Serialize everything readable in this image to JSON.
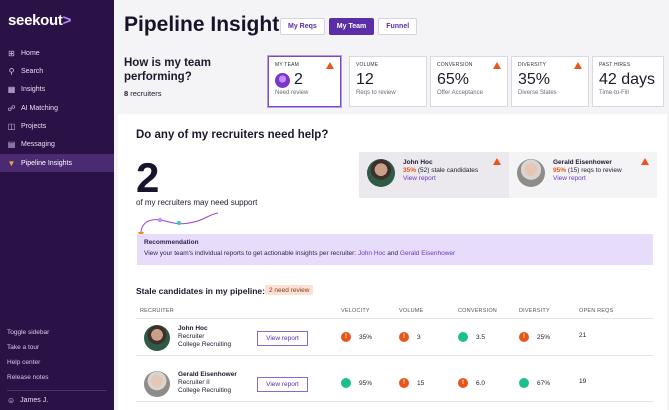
{
  "sidebar": {
    "logo": "seekout",
    "logo_arrow": ">",
    "items": [
      {
        "label": "Home",
        "icon": "home-icon"
      },
      {
        "label": "Search",
        "icon": "search-icon"
      },
      {
        "label": "Insights",
        "icon": "insights-icon"
      },
      {
        "label": "AI Matching",
        "icon": "ai-matching-icon"
      },
      {
        "label": "Projects",
        "icon": "projects-icon"
      },
      {
        "label": "Messaging",
        "icon": "messaging-icon"
      },
      {
        "label": "Pipeline Insights",
        "icon": "pipeline-icon"
      }
    ],
    "bottom": [
      "Toggle sidebar",
      "Take a tour",
      "Help center",
      "Release notes"
    ],
    "user": "James J."
  },
  "header": {
    "title": "Pipeline Insights",
    "tabs": [
      "My Reqs",
      "My Team",
      "Funnel"
    ]
  },
  "summary": {
    "question": "How is my team performing?",
    "recruiters_count": "8",
    "recruiters_label": "recruiters",
    "cards": [
      {
        "label": "MY TEAM",
        "value": "2",
        "sub": "Need review"
      },
      {
        "label": "VOLUME",
        "value": "12",
        "sub": "Reqs to review"
      },
      {
        "label": "CONVERSION",
        "value": "65%",
        "sub": "Offer Acceptance"
      },
      {
        "label": "DIVERSITY",
        "value": "35%",
        "sub": "Diverse Slates"
      },
      {
        "label": "PAST HIRES",
        "value": "42 days",
        "sub": "Time-to-Fill"
      }
    ]
  },
  "help": {
    "title": "Do any of my recruiters need help?",
    "count": "2",
    "caption": "of my recruiters may need support",
    "cards": [
      {
        "name": "John Hoc",
        "pct": "35%",
        "detail": "(52) stale candidates",
        "link": "View report"
      },
      {
        "name": "Gerald Eisenhower",
        "pct": "95%",
        "detail": "(15) reqs to review",
        "link": "View report"
      }
    ],
    "recommendation_title": "Recommendation",
    "recommendation_text": "View your team's individual reports to get actionable insights per recruiter:",
    "rec_link1": "John Hoc",
    "rec_and": "and",
    "rec_link2": "Gerald Eisenhower"
  },
  "stale": {
    "title": "Stale candidates in my pipeline:",
    "badge": "2 need review",
    "columns": [
      "RECRUITER",
      "VELOCITY",
      "VOLUME",
      "CONVERSION",
      "DIVERSITY",
      "OPEN REQS"
    ],
    "rows": [
      {
        "name": "John Hoc",
        "role": "Recruiter",
        "team": "College Recruiting",
        "button": "View report",
        "velocity": "35%",
        "volume": "3",
        "conversion": "3.5",
        "diversity": "25%",
        "open_reqs": "21"
      },
      {
        "name": "Gerald Eisenhower",
        "role": "Recruiter II",
        "team": "College Recruiting",
        "button": "View report",
        "velocity": "95%",
        "volume": "15",
        "conversion": "6.0",
        "diversity": "67%",
        "open_reqs": "19"
      }
    ]
  },
  "colors": {
    "brand": "#2b1246",
    "accent": "#5a2ea6",
    "warning": "#e9541b",
    "good": "#1ebf8f"
  }
}
